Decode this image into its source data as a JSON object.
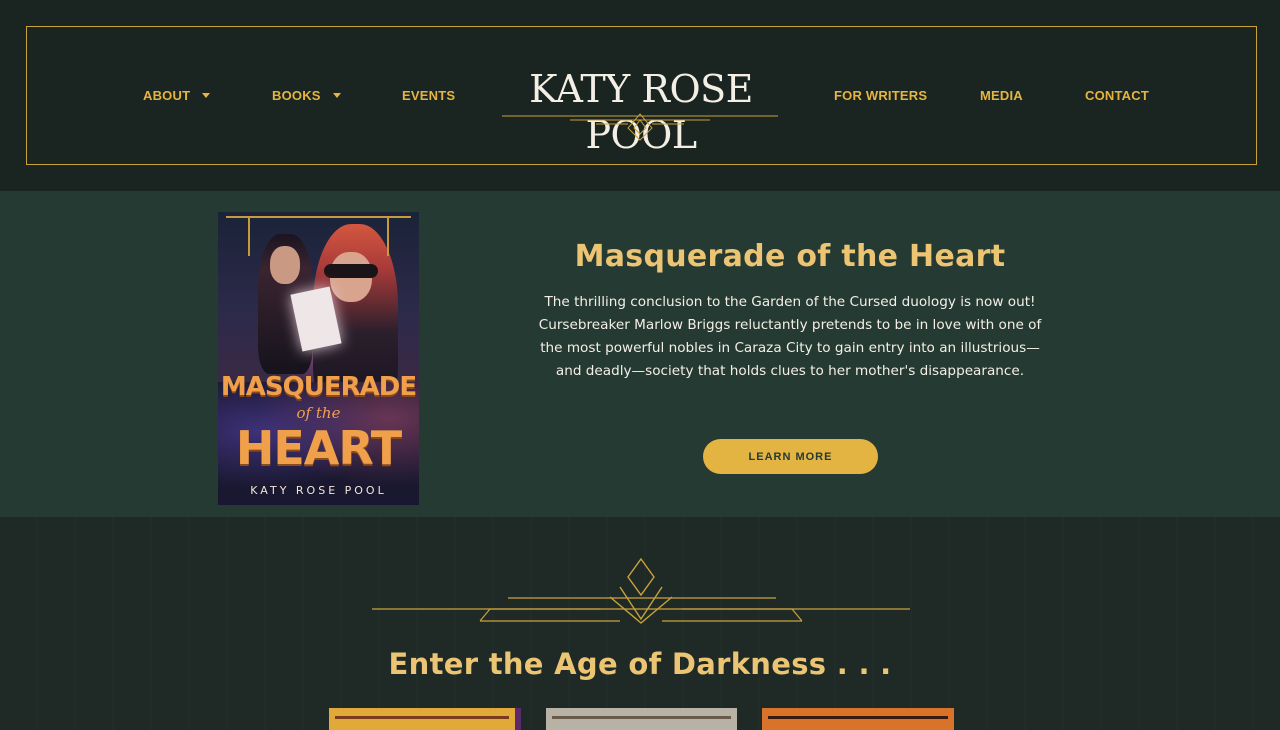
{
  "header": {
    "logo_text": "KATY ROSE POOL",
    "nav": {
      "about": "ABOUT",
      "books": "BOOKS",
      "events": "EVENTS",
      "for_writers": "FOR WRITERS",
      "media": "MEDIA",
      "contact": "CONTACT"
    }
  },
  "feature": {
    "title": "Masquerade of the Heart",
    "description": "The thrilling conclusion to the Garden of the Cursed duology is now out! Cursebreaker Marlow Briggs reluctantly pretends to be in love with one of the most powerful nobles in Caraza City to gain entry into an illustrious—and deadly—society that holds clues to her mother's disappearance.",
    "button_label": "LEARN MORE",
    "cover": {
      "title_line1": "MASQUERADE",
      "title_line2": "of the",
      "title_line3": "HEART",
      "author": "KATY ROSE POOL"
    }
  },
  "section2": {
    "title": "Enter the Age of Darkness . . ."
  },
  "colors": {
    "gold": "#e6b53f",
    "header_bg": "#1a2420",
    "feature_bg": "#263a34",
    "title_gold": "#ecc574"
  },
  "icons": {
    "dropdown": "caret-down-icon",
    "ornament": "art-deco-ornament"
  }
}
